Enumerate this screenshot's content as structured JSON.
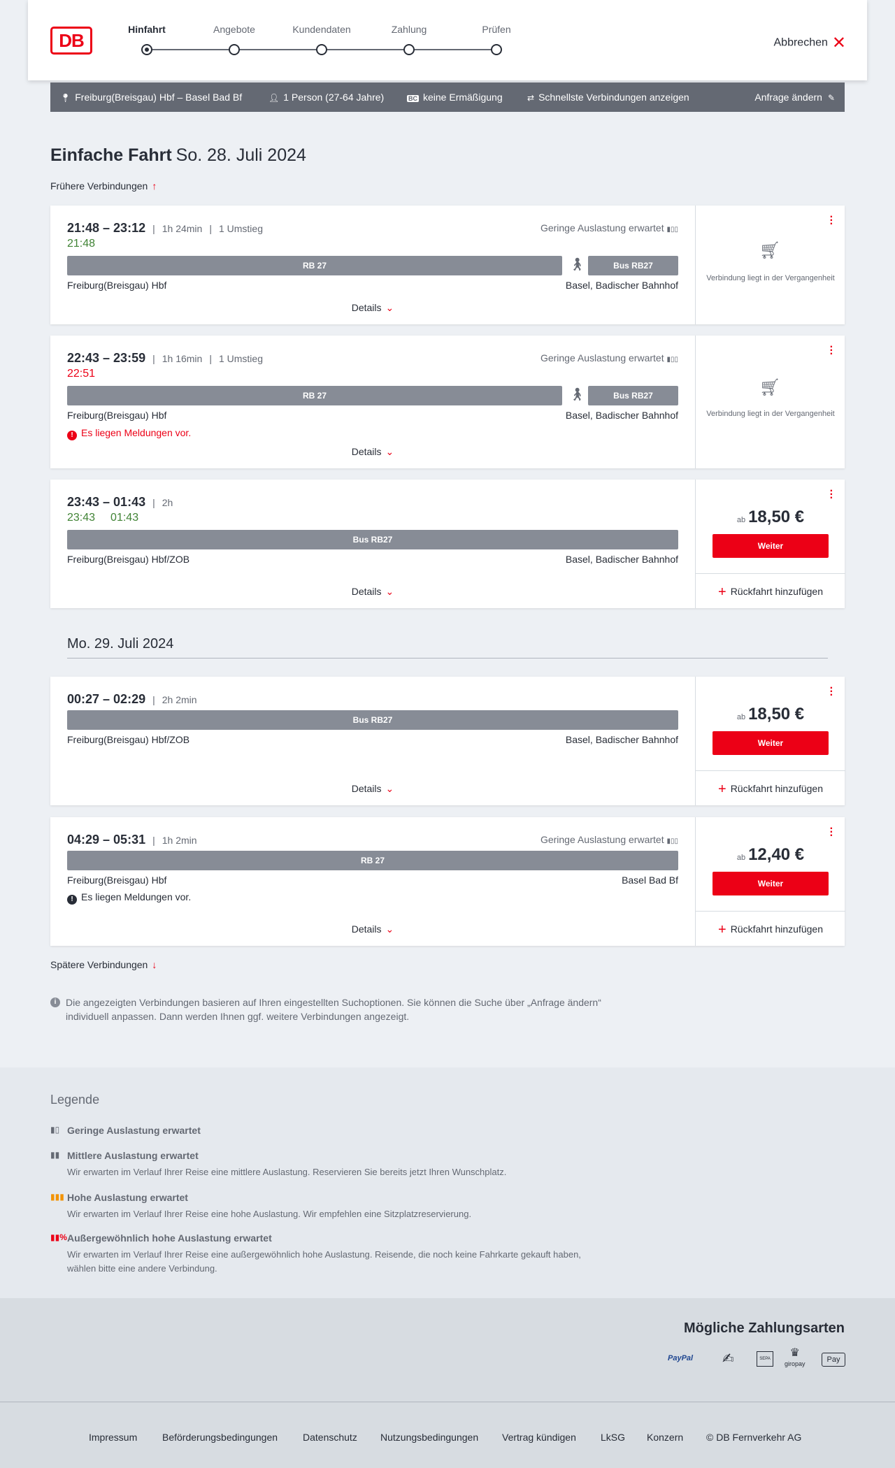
{
  "header": {
    "logo": "DB",
    "steps": [
      "Hinfahrt",
      "Angebote",
      "Kundendaten",
      "Zahlung",
      "Prüfen"
    ],
    "cancel": "Abbrechen"
  },
  "search": {
    "route": "Freiburg(Breisgau) Hbf – Basel Bad Bf",
    "passengers": "1 Person (27-64 Jahre)",
    "discount": "keine Ermäßigung",
    "fastest": "Schnellste Verbindungen anzeigen",
    "change": "Anfrage ändern"
  },
  "page": {
    "title": "Einfache Fahrt",
    "date": "So. 28. Juli 2024",
    "earlier": "Frühere Verbindungen",
    "later": "Spätere Verbindungen",
    "day2": "Mo. 29. Juli 2024"
  },
  "labels": {
    "load": "Geringe Auslastung erwartet",
    "details": "Details",
    "past": "Verbindung liegt in der Vergangenheit",
    "ab": "ab",
    "weiter": "Weiter",
    "retour": "Rückfahrt hinzufügen",
    "message": "Es liegen Meldungen vor."
  },
  "connections": [
    {
      "times": "21:48 – 23:12",
      "duration": "1h 24min",
      "transfers": "1 Umstieg",
      "rt1": "21:48",
      "rt2": "",
      "bar1": "RB 27",
      "bar2": "Bus RB27",
      "from": "Freiburg(Breisgau) Hbf",
      "to": "Basel, Badischer Bahnhof"
    },
    {
      "times": "22:43 – 23:59",
      "duration": "1h 16min",
      "transfers": "1 Umstieg",
      "rt1": "22:51",
      "rt2": "",
      "bar1": "RB 27",
      "bar2": "Bus RB27",
      "from": "Freiburg(Breisgau) Hbf",
      "to": "Basel, Badischer Bahnhof"
    },
    {
      "times": "23:43 – 01:43",
      "duration": "2h",
      "transfers": "",
      "rt1": "23:43",
      "rt2": "01:43",
      "bar1": "Bus RB27",
      "bar2": "",
      "from": "Freiburg(Breisgau) Hbf/ZOB",
      "to": "Basel, Badischer Bahnhof",
      "price": "18,50 €"
    },
    {
      "times": "00:27 – 02:29",
      "duration": "2h 2min",
      "transfers": "",
      "rt1": "",
      "rt2": "",
      "bar1": "Bus RB27",
      "bar2": "",
      "from": "Freiburg(Breisgau) Hbf/ZOB",
      "to": "Basel, Badischer Bahnhof",
      "price": "18,50 €"
    },
    {
      "times": "04:29 – 05:31",
      "duration": "1h 2min",
      "transfers": "",
      "rt1": "",
      "rt2": "",
      "bar1": "RB 27",
      "bar2": "",
      "from": "Freiburg(Breisgau) Hbf",
      "to": "Basel Bad Bf",
      "price": "12,40 €"
    }
  ],
  "info": "Die angezeigten Verbindungen basieren auf Ihren eingestellten Suchoptionen. Sie können die Suche über „Anfrage ändern“ individuell anpassen. Dann werden Ihnen ggf. weitere Verbindungen angezeigt.",
  "legend": {
    "title": "Legende",
    "items": [
      {
        "title": "Geringe Auslastung erwartet",
        "desc": ""
      },
      {
        "title": "Mittlere Auslastung erwartet",
        "desc": "Wir erwarten im Verlauf Ihrer Reise eine mittlere Auslastung. Reservieren Sie bereits jetzt Ihren Wunschplatz."
      },
      {
        "title": "Hohe Auslastung erwartet",
        "desc": "Wir erwarten im Verlauf Ihrer Reise eine hohe Auslastung. Wir empfehlen eine Sitzplatzreservierung."
      },
      {
        "title": "Außergewöhnlich hohe Auslastung erwartet",
        "desc": "Wir erwarten im Verlauf Ihrer Reise eine außergewöhnlich hohe Auslastung. Reisende, die noch keine Fahrkarte gekauft haben, wählen bitte eine andere Verbindung."
      }
    ]
  },
  "payment": {
    "title": "Mögliche Zahlungsarten",
    "methods": [
      "PayPal",
      "SEPA",
      "giropay",
      "Pay"
    ]
  },
  "footer": [
    "Impressum",
    "Beförderungsbedingungen",
    "Datenschutz",
    "Nutzungsbedingungen",
    "Vertrag kündigen",
    "LkSG",
    "Konzern",
    "© DB Fernverkehr AG"
  ],
  "colors": {
    "brand": "#ec0016",
    "bar": "#878c96",
    "green": "#408335"
  }
}
